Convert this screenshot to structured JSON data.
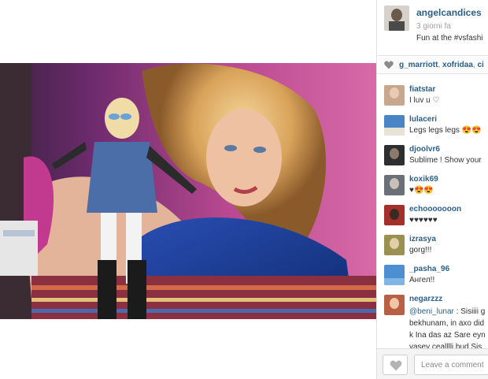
{
  "post": {
    "owner_username": "angelcandices",
    "time_ago": "3 giorni fa",
    "caption": "Fun at the #vsfashi"
  },
  "likes": {
    "users": [
      "g_marriott",
      "xofridaa",
      "ci"
    ]
  },
  "comments": [
    {
      "username": "fiatstar",
      "text": "I luv u ♡",
      "avatar_color": "#c9a78e"
    },
    {
      "username": "lulaceri",
      "text": "Legs legs legs 😍😍",
      "avatar_color": "#4a86c5"
    },
    {
      "username": "djoolvr6",
      "text": "Sublime ! Show your",
      "avatar_color": "#2e2e2e"
    },
    {
      "username": "koxik69",
      "text": "♥😍😍",
      "avatar_color": "#6b6f78"
    },
    {
      "username": "echooooooon",
      "text": "♥♥♥♥♥♥",
      "avatar_color": "#a3302b"
    },
    {
      "username": "izrasya",
      "text": "gorg!!!",
      "avatar_color": "#9a9050"
    },
    {
      "username": "_pasha_96",
      "text": "Ангел!!",
      "avatar_color": "#4d8fd0"
    },
    {
      "username": "negarzzz",
      "mention": "@beni_lunar",
      "text": " : Sisiiii g",
      "lines": [
        "bekhunam, in axo did",
        "k Ina das az Sare eyn",
        "yasey cealllli bud Sis"
      ],
      "avatar_color": "#b85f45"
    }
  ],
  "comment_box": {
    "placeholder": "Leave a comment"
  },
  "icons": {
    "like": "heart-icon",
    "like_button": "heart-icon"
  },
  "colors": {
    "link": "#2c5f8a",
    "panel_border": "#e2e2e2"
  }
}
